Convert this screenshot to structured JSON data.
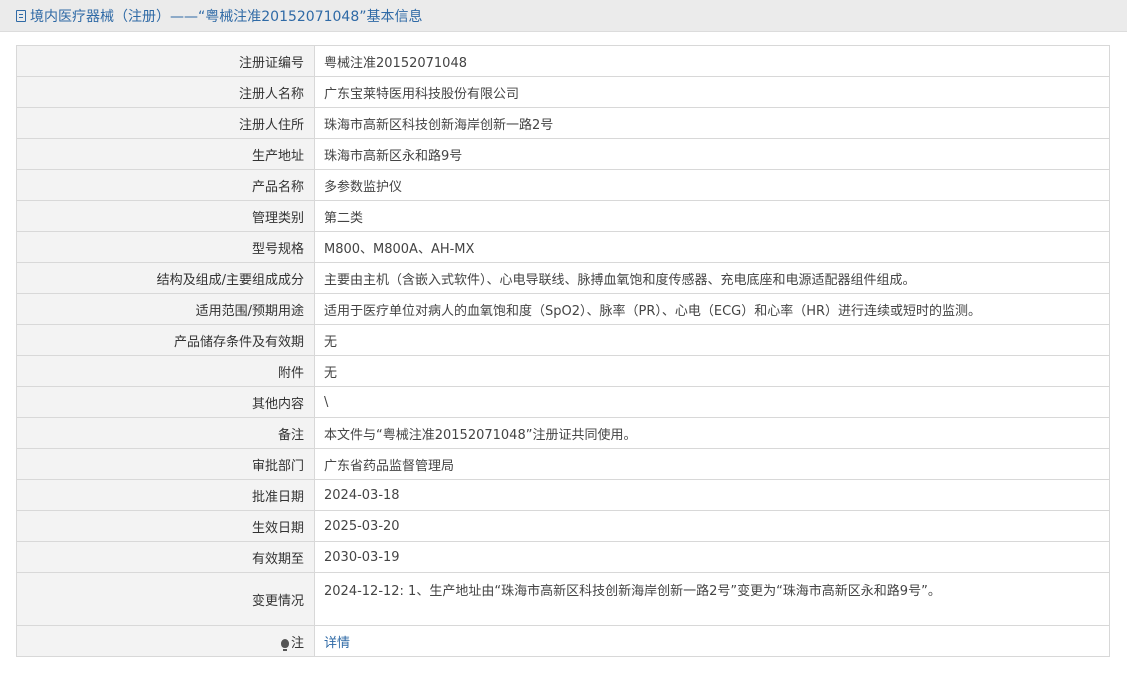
{
  "header": {
    "title": "境内医疗器械（注册）——“粤械注准20152071048”基本信息",
    "icon": "document-icon"
  },
  "rows": [
    {
      "label": "注册证编号",
      "value": "粤械注准20152071048"
    },
    {
      "label": "注册人名称",
      "value": "广东宝莱特医用科技股份有限公司"
    },
    {
      "label": "注册人住所",
      "value": "珠海市高新区科技创新海岸创新一路2号"
    },
    {
      "label": "生产地址",
      "value": "珠海市高新区永和路9号"
    },
    {
      "label": "产品名称",
      "value": "多参数监护仪"
    },
    {
      "label": "管理类别",
      "value": "第二类"
    },
    {
      "label": "型号规格",
      "value": "M800、M800A、AH-MX"
    },
    {
      "label": "结构及组成/主要组成成分",
      "value": "主要由主机（含嵌入式软件）、心电导联线、脉搏血氧饱和度传感器、充电底座和电源适配器组件组成。"
    },
    {
      "label": "适用范围/预期用途",
      "value": "适用于医疗单位对病人的血氧饱和度（SpO2）、脉率（PR）、心电（ECG）和心率（HR）进行连续或短时的监测。"
    },
    {
      "label": "产品储存条件及有效期",
      "value": "无"
    },
    {
      "label": "附件",
      "value": "无"
    },
    {
      "label": "其他内容",
      "value": "\\"
    },
    {
      "label": "备注",
      "value": "本文件与“粤械注准20152071048”注册证共同使用。"
    },
    {
      "label": "审批部门",
      "value": "广东省药品监督管理局"
    },
    {
      "label": "批准日期",
      "value": "2024-03-18"
    },
    {
      "label": "生效日期",
      "value": "2025-03-20"
    },
    {
      "label": "有效期至",
      "value": "2030-03-19"
    }
  ],
  "change": {
    "label": "变更情况",
    "value": "2024-12-12: 1、生产地址由“珠海市高新区科技创新海岸创新一路2号”变更为“珠海市高新区永和路9号”。"
  },
  "note": {
    "label": "注",
    "icon": "lightbulb-icon",
    "link_text": "详情"
  },
  "colors": {
    "title_text": "#2f6aa6",
    "link": "#2f6aa6",
    "label_bg": "#f3f3f3",
    "border": "#d8d8d8"
  }
}
